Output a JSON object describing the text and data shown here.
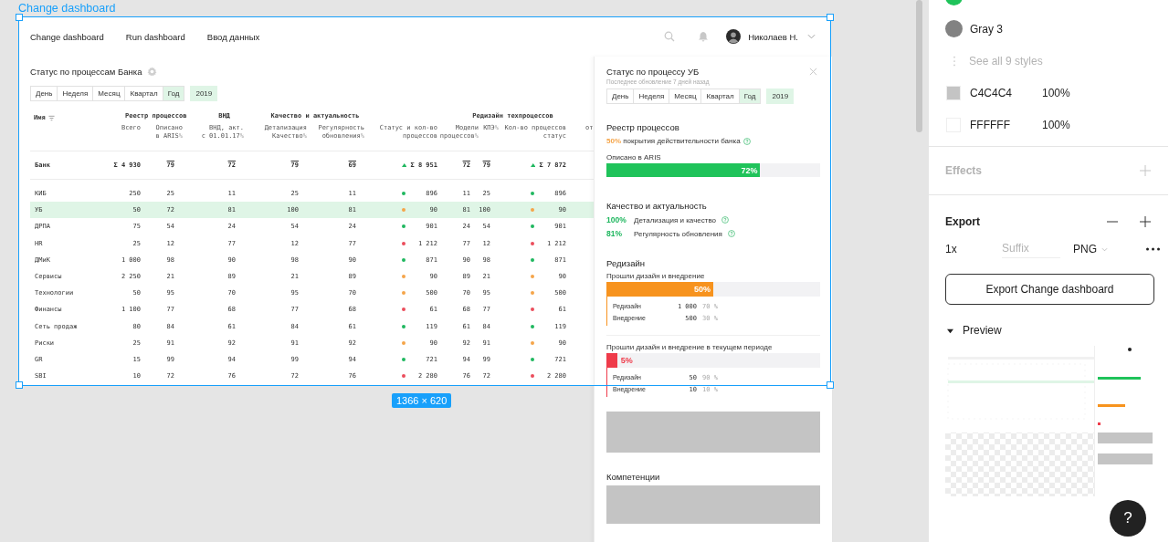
{
  "frame_label": "Change dashboard",
  "size_badge": "1366 × 620",
  "dashboard": {
    "nav": [
      "Change dashboard",
      "Run dashboard",
      "Ввод данных"
    ],
    "user": "Николаев Н.",
    "table": {
      "title": "Статус по процессам Банка",
      "periods": [
        {
          "label": "День",
          "selected": false
        },
        {
          "label": "Неделя",
          "selected": false
        },
        {
          "label": "Месяц",
          "selected": false
        },
        {
          "label": "Квартал",
          "selected": false
        },
        {
          "label": "Год",
          "selected": true
        }
      ],
      "year": "2019",
      "name_header": "Имя",
      "groups": [
        {
          "label": "Реестр процессов",
          "columns": [
            {
              "label": "Всего",
              "kind": "number"
            },
            {
              "label": "Описано\nв ARIS",
              "unit": "%",
              "kind": "number"
            }
          ]
        },
        {
          "label": "ВНД",
          "columns": [
            {
              "label": "ВНД, акт.\nс 01.01.17",
              "unit": "%",
              "kind": "number"
            }
          ]
        },
        {
          "label": "Качество и актуальность",
          "columns": [
            {
              "label": "Детализация\nКачество",
              "unit": "%",
              "kind": "number"
            },
            {
              "label": "Регулярность\nобновления",
              "unit": "%",
              "kind": "number"
            }
          ]
        },
        {
          "columns": [
            {
              "label": "Статус и кол-во\nпроцессов",
              "kind": "status"
            }
          ]
        },
        {
          "label": "Редизайн техпроцессов",
          "columns": [
            {
              "label": "Модели\nпроцессов",
              "unit": "%",
              "kind": "number"
            },
            {
              "label": "КПЭ",
              "unit": "%",
              "kind": "number"
            },
            {
              "label": "Кол-во процессов\nстатус",
              "kind": "status"
            }
          ]
        },
        {
          "columns": [
            {
              "label": "от",
              "kind": "text"
            }
          ]
        }
      ],
      "rows": [
        {
          "name": "Банк",
          "kind": "total",
          "selected": false,
          "cells": [
            {
              "value": "Σ 4 930"
            },
            {
              "value": "79",
              "mean": true
            },
            {
              "value": "72",
              "mean": true
            },
            {
              "value": "79",
              "mean": true
            },
            {
              "value": "69",
              "mean": true
            },
            {
              "value": "Σ 8 951",
              "trend_up": true
            },
            {
              "value": "72",
              "mean": true
            },
            {
              "value": "79",
              "mean": true
            },
            {
              "value": "Σ 7 872",
              "trend_up": true
            }
          ]
        },
        {
          "name": "КИБ",
          "kind": "item",
          "selected": false,
          "cells": [
            {
              "value": "250"
            },
            {
              "value": "25"
            },
            {
              "value": "11"
            },
            {
              "value": "25"
            },
            {
              "value": "11"
            },
            {
              "value": "896",
              "color": "#1fb75f"
            },
            {
              "value": "11"
            },
            {
              "value": "25"
            },
            {
              "value": "896",
              "color": "#1fb75f"
            }
          ]
        },
        {
          "name": "УБ",
          "kind": "item",
          "selected": true,
          "cells": [
            {
              "value": "50"
            },
            {
              "value": "72"
            },
            {
              "value": "81"
            },
            {
              "value": "100"
            },
            {
              "value": "81"
            },
            {
              "value": "90",
              "color": "#f5a54a"
            },
            {
              "value": "81"
            },
            {
              "value": "100"
            },
            {
              "value": "90",
              "color": "#f5a54a"
            }
          ]
        },
        {
          "name": "ДРПА",
          "kind": "item",
          "selected": false,
          "cells": [
            {
              "value": "75"
            },
            {
              "value": "54"
            },
            {
              "value": "24"
            },
            {
              "value": "54"
            },
            {
              "value": "24"
            },
            {
              "value": "901",
              "color": "#1fb75f"
            },
            {
              "value": "24"
            },
            {
              "value": "54"
            },
            {
              "value": "901",
              "color": "#1fb75f"
            }
          ]
        },
        {
          "name": "HR",
          "kind": "item",
          "selected": false,
          "cells": [
            {
              "value": "25"
            },
            {
              "value": "12"
            },
            {
              "value": "77"
            },
            {
              "value": "12"
            },
            {
              "value": "77"
            },
            {
              "value": "1 212",
              "color": "#eb4d5c"
            },
            {
              "value": "77"
            },
            {
              "value": "12"
            },
            {
              "value": "1 212",
              "color": "#eb4d5c"
            }
          ]
        },
        {
          "name": "ДМиК",
          "kind": "item",
          "selected": false,
          "cells": [
            {
              "value": "1 000"
            },
            {
              "value": "98"
            },
            {
              "value": "90"
            },
            {
              "value": "98"
            },
            {
              "value": "90"
            },
            {
              "value": "871",
              "color": "#1fb75f"
            },
            {
              "value": "90"
            },
            {
              "value": "98"
            },
            {
              "value": "871",
              "color": "#1fb75f"
            }
          ]
        },
        {
          "name": "Сервисы",
          "kind": "item",
          "selected": false,
          "cells": [
            {
              "value": "2 250"
            },
            {
              "value": "21"
            },
            {
              "value": "89"
            },
            {
              "value": "21"
            },
            {
              "value": "89"
            },
            {
              "value": "90",
              "color": "#f5a54a"
            },
            {
              "value": "89"
            },
            {
              "value": "21"
            },
            {
              "value": "90",
              "color": "#f5a54a"
            }
          ]
        },
        {
          "name": "Технологии",
          "kind": "item",
          "selected": false,
          "cells": [
            {
              "value": "50"
            },
            {
              "value": "95"
            },
            {
              "value": "70"
            },
            {
              "value": "95"
            },
            {
              "value": "70"
            },
            {
              "value": "500",
              "color": "#f5a54a"
            },
            {
              "value": "70"
            },
            {
              "value": "95"
            },
            {
              "value": "500",
              "color": "#f5a54a"
            }
          ]
        },
        {
          "name": "Финансы",
          "kind": "item",
          "selected": false,
          "cells": [
            {
              "value": "1 100"
            },
            {
              "value": "77"
            },
            {
              "value": "68"
            },
            {
              "value": "77"
            },
            {
              "value": "68"
            },
            {
              "value": "61",
              "color": "#eb4d5c"
            },
            {
              "value": "68"
            },
            {
              "value": "77"
            },
            {
              "value": "61",
              "color": "#eb4d5c"
            }
          ]
        },
        {
          "name": "Сеть продаж",
          "kind": "item",
          "selected": false,
          "cells": [
            {
              "value": "80"
            },
            {
              "value": "84"
            },
            {
              "value": "61"
            },
            {
              "value": "84"
            },
            {
              "value": "61"
            },
            {
              "value": "119",
              "color": "#1fb75f"
            },
            {
              "value": "61"
            },
            {
              "value": "84"
            },
            {
              "value": "119",
              "color": "#1fb75f"
            }
          ]
        },
        {
          "name": "Риски",
          "kind": "item",
          "selected": false,
          "cells": [
            {
              "value": "25"
            },
            {
              "value": "91"
            },
            {
              "value": "92"
            },
            {
              "value": "91"
            },
            {
              "value": "92"
            },
            {
              "value": "90",
              "color": "#f5a54a"
            },
            {
              "value": "92"
            },
            {
              "value": "91"
            },
            {
              "value": "90",
              "color": "#f5a54a"
            }
          ]
        },
        {
          "name": "GR",
          "kind": "item",
          "selected": false,
          "cells": [
            {
              "value": "15"
            },
            {
              "value": "99"
            },
            {
              "value": "94"
            },
            {
              "value": "99"
            },
            {
              "value": "94"
            },
            {
              "value": "721",
              "color": "#1fb75f"
            },
            {
              "value": "94"
            },
            {
              "value": "99"
            },
            {
              "value": "721",
              "color": "#1fb75f"
            }
          ]
        },
        {
          "name": "SBI",
          "kind": "item",
          "selected": false,
          "cells": [
            {
              "value": "10"
            },
            {
              "value": "72"
            },
            {
              "value": "76"
            },
            {
              "value": "72"
            },
            {
              "value": "76"
            },
            {
              "value": "2 280",
              "color": "#eb4d5c"
            },
            {
              "value": "76"
            },
            {
              "value": "72"
            },
            {
              "value": "2 280",
              "color": "#eb4d5c"
            }
          ]
        }
      ]
    },
    "detail": {
      "title": "Статус по процессу УБ",
      "subtitle": "Последнее обновление 7 дней назад",
      "periods": [
        {
          "label": "День",
          "selected": false
        },
        {
          "label": "Неделя",
          "selected": false
        },
        {
          "label": "Месяц",
          "selected": false
        },
        {
          "label": "Квартал",
          "selected": false
        },
        {
          "label": "Год",
          "selected": true
        }
      ],
      "year": "2019",
      "registry": {
        "title": "Реестр процессов",
        "stat_value": "50%",
        "stat_label": "покрытия действительности банка",
        "bar_label": "Описано в ARIS",
        "level": 0.72,
        "reading": "72%"
      },
      "quality": {
        "title": "Качество и актуальность",
        "metrics": [
          {
            "value": "100%",
            "label": "Детализация и качество"
          },
          {
            "value": "81%",
            "label": "Регулярность обновления"
          }
        ]
      },
      "redesign": {
        "title": "Редизайн",
        "blocks": [
          {
            "label": "Прошли дизайн и внедрение",
            "level": 0.5,
            "reading": "50%",
            "color": "#f7931e",
            "rows": [
              {
                "name": "Редизайн",
                "count": "1 000",
                "share": "70 %"
              },
              {
                "name": "Внедрение",
                "count": "500",
                "share": "30 %"
              }
            ]
          },
          {
            "label": "Прошли дизайн и внедрение в текущем периоде",
            "level": 0.05,
            "reading": "5%",
            "color": "#ef3b4a",
            "rows": [
              {
                "name": "Редизайн",
                "count": "50",
                "share": "90 %"
              },
              {
                "name": "Внедрение",
                "count": "10",
                "share": "10 %"
              }
            ]
          }
        ]
      },
      "competencies": {
        "title": "Компетенции"
      }
    }
  },
  "inspector": {
    "styles": [
      {
        "color": "#1fc35a"
      },
      {
        "name": "Gray 3",
        "color": "#828282"
      }
    ],
    "see_all": "See all 9 styles",
    "fills": [
      {
        "hex": "C4C4C4",
        "opacity": "100%",
        "color": "#c4c4c4"
      },
      {
        "hex": "FFFFFF",
        "opacity": "100%",
        "color": "#ffffff"
      }
    ],
    "effects": {
      "title": "Effects"
    },
    "export": {
      "title": "Export",
      "scale": "1x",
      "suffix_placeholder": "Suffix",
      "format": "PNG",
      "button": "Export Change dashboard"
    },
    "preview": {
      "title": "Preview",
      "expanded": true
    }
  },
  "help_button": "?"
}
